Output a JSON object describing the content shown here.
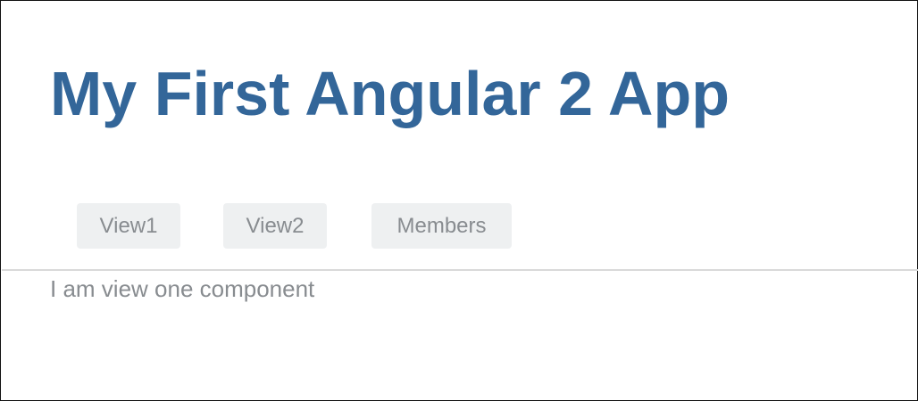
{
  "app": {
    "title": "My First Angular 2 App"
  },
  "nav": {
    "items": [
      {
        "label": "View1"
      },
      {
        "label": "View2"
      },
      {
        "label": "Members"
      }
    ]
  },
  "content": {
    "text": "I am view one component"
  },
  "colors": {
    "title": "#336699",
    "nav_background": "#eef0f1",
    "nav_text": "#888c90",
    "divider": "#d9d9d9",
    "body_text": "#888c90"
  }
}
